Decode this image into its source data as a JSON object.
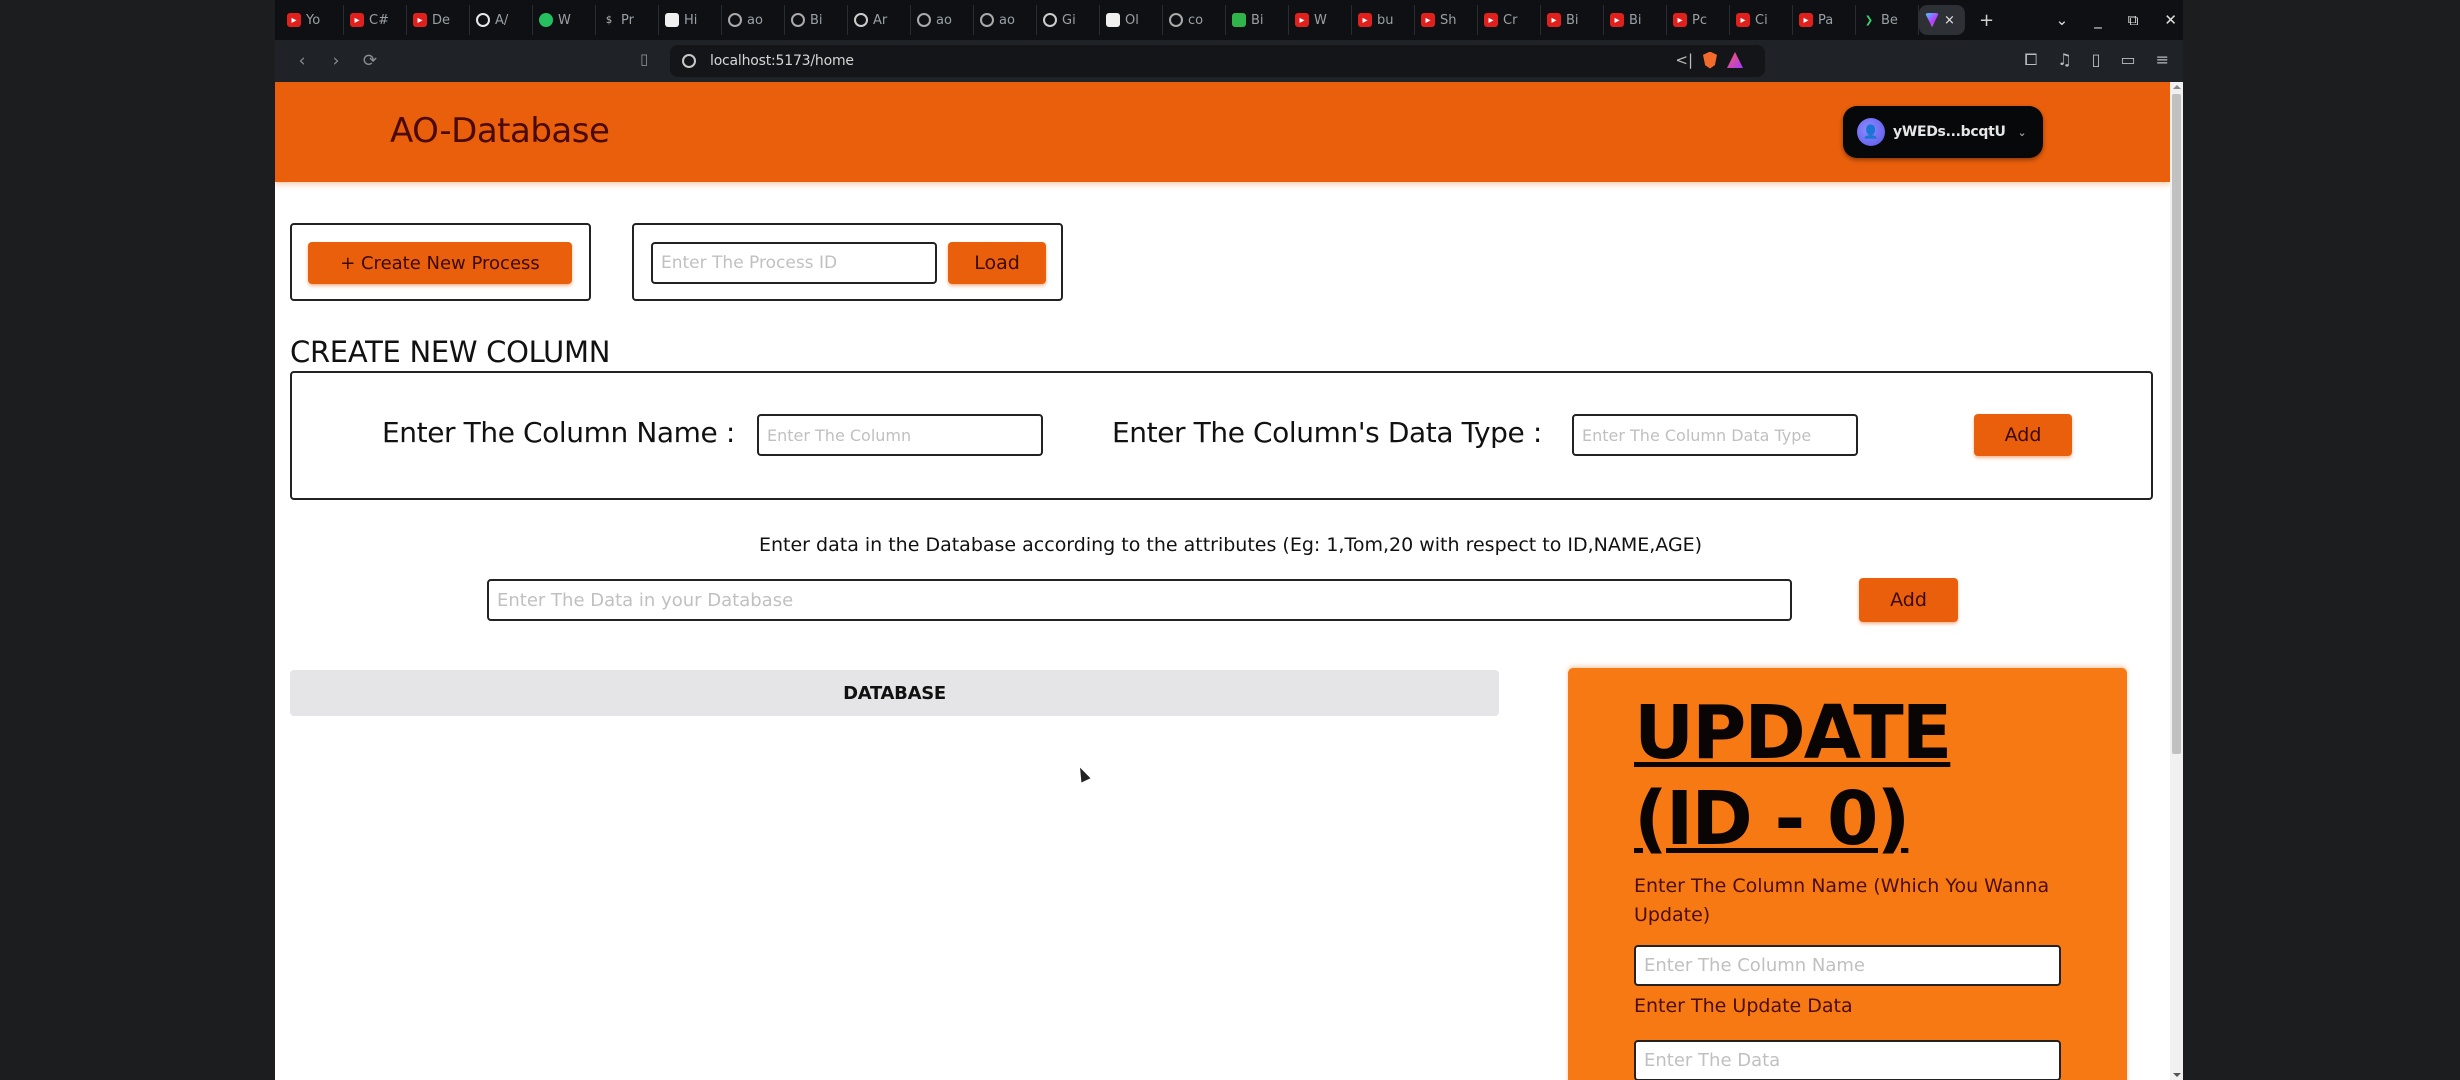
{
  "browser": {
    "tabs": [
      {
        "icon": "youtube-icon",
        "label": "Yo"
      },
      {
        "icon": "youtube-icon",
        "label": "C#"
      },
      {
        "icon": "youtube-icon",
        "label": "De"
      },
      {
        "icon": "github-icon",
        "label": "A/"
      },
      {
        "icon": "whatsapp-icon",
        "label": "W"
      },
      {
        "icon": "dollar-icon",
        "label": "Pr"
      },
      {
        "icon": "app-icon",
        "label": "Hi"
      },
      {
        "icon": "ao-icon",
        "label": "ao"
      },
      {
        "icon": "ao-icon",
        "label": "Bi"
      },
      {
        "icon": "globe-icon",
        "label": "Ar"
      },
      {
        "icon": "ao-icon",
        "label": "ao"
      },
      {
        "icon": "ao-icon",
        "label": "ao"
      },
      {
        "icon": "globe-icon",
        "label": "Gi"
      },
      {
        "icon": "app-icon",
        "label": "Ol"
      },
      {
        "icon": "ao-icon",
        "label": "co"
      },
      {
        "icon": "green-app-icon",
        "label": "Bi"
      },
      {
        "icon": "youtube-icon",
        "label": "W"
      },
      {
        "icon": "youtube-icon",
        "label": "bu"
      },
      {
        "icon": "youtube-icon",
        "label": "Sh"
      },
      {
        "icon": "youtube-icon",
        "label": "Cr"
      },
      {
        "icon": "youtube-icon",
        "label": "Bi"
      },
      {
        "icon": "youtube-icon",
        "label": "Bi"
      },
      {
        "icon": "youtube-icon",
        "label": "Pc"
      },
      {
        "icon": "youtube-icon",
        "label": "Ci"
      },
      {
        "icon": "youtube-icon",
        "label": "Pa"
      },
      {
        "icon": "green-arrow-icon",
        "label": "Be"
      }
    ],
    "active_tab_close": "×",
    "new_tab": "+",
    "window_controls": {
      "tab_search": "⌄",
      "minimize": "_",
      "restore": "⧉",
      "close": "✕"
    },
    "nav": {
      "back": "‹",
      "forward": "›",
      "reload": "⟳",
      "bookmark": "▯"
    },
    "url": "localhost:5173/home",
    "share_icon": "<|"
  },
  "app": {
    "title": "AO-Database",
    "wallet": {
      "address": "yWEDs...bcqtU",
      "chevron": "⌄"
    },
    "create_process_label": "+ Create New Process",
    "process_id_placeholder": "Enter The Process ID",
    "load_label": "Load",
    "create_column": {
      "title": "CREATE NEW COLUMN",
      "name_label": "Enter The Column Name :",
      "name_placeholder": "Enter The Column",
      "type_label": "Enter The Column's Data Type :",
      "type_placeholder": "Enter The Column Data Type",
      "add_label": "Add"
    },
    "data_entry": {
      "hint": "Enter data in the Database according to the attributes (Eg: 1,Tom,20 with respect to ID,NAME,AGE)",
      "placeholder": "Enter The Data in your Database",
      "add_label": "Add"
    },
    "database": {
      "header": "DATABASE",
      "rows": []
    },
    "update": {
      "title_line1": "UPDATE",
      "title_line2": "(ID - 0)",
      "column_label": "Enter The Column Name (Which You Wanna Update)",
      "column_placeholder": "Enter The Column Name",
      "data_label": "Enter The Update Data",
      "data_placeholder": "Enter The Data"
    }
  },
  "colors": {
    "brand_orange": "#e95f0c",
    "update_card_orange": "#f77914",
    "db_header_bg": "#e5e5e7"
  }
}
